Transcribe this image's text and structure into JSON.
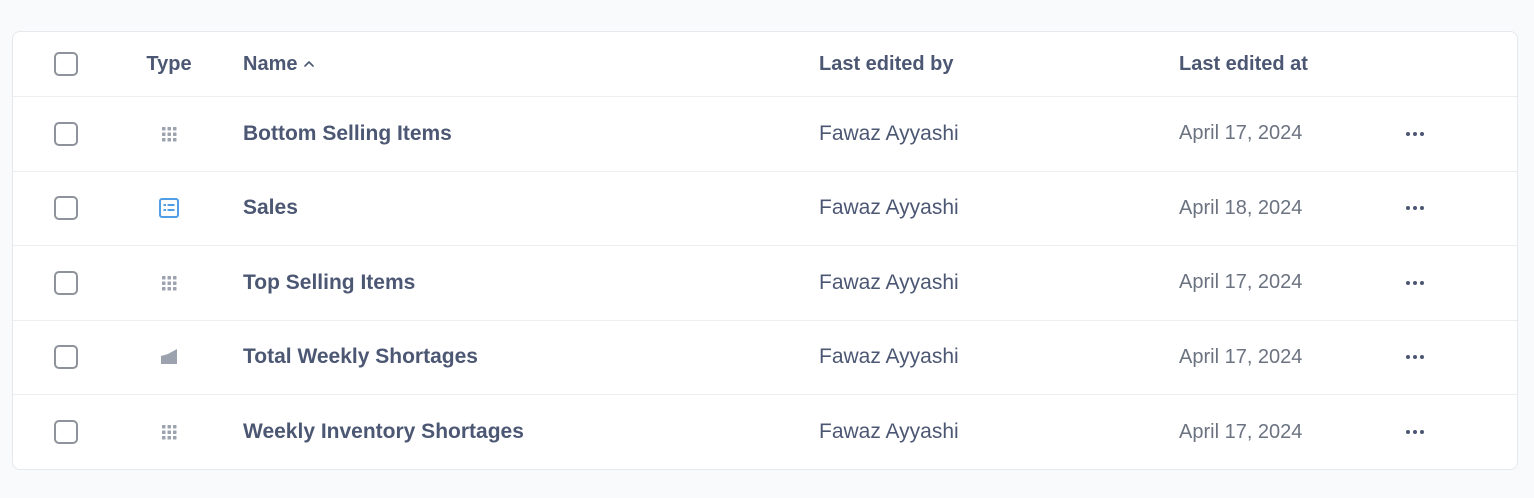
{
  "table": {
    "columns": {
      "type": "Type",
      "name": "Name",
      "last_edited_by": "Last edited by",
      "last_edited_at": "Last edited at"
    },
    "rows": [
      {
        "icon": "grid-icon",
        "name": "Bottom Selling Items",
        "last_edited_by": "Fawaz Ayyashi",
        "last_edited_at": "April 17, 2024"
      },
      {
        "icon": "model-icon",
        "name": "Sales",
        "last_edited_by": "Fawaz Ayyashi",
        "last_edited_at": "April 18, 2024"
      },
      {
        "icon": "grid-icon",
        "name": "Top Selling Items",
        "last_edited_by": "Fawaz Ayyashi",
        "last_edited_at": "April 17, 2024"
      },
      {
        "icon": "area-chart-icon",
        "name": "Total Weekly Shortages",
        "last_edited_by": "Fawaz Ayyashi",
        "last_edited_at": "April 17, 2024"
      },
      {
        "icon": "grid-icon",
        "name": "Weekly Inventory Shortages",
        "last_edited_by": "Fawaz Ayyashi",
        "last_edited_at": "April 17, 2024"
      }
    ]
  },
  "colors": {
    "text": "#4c5773",
    "muted": "#6b7280",
    "grid_icon": "#9ca3af",
    "model_icon": "#509ee3",
    "border": "#eceef0"
  }
}
